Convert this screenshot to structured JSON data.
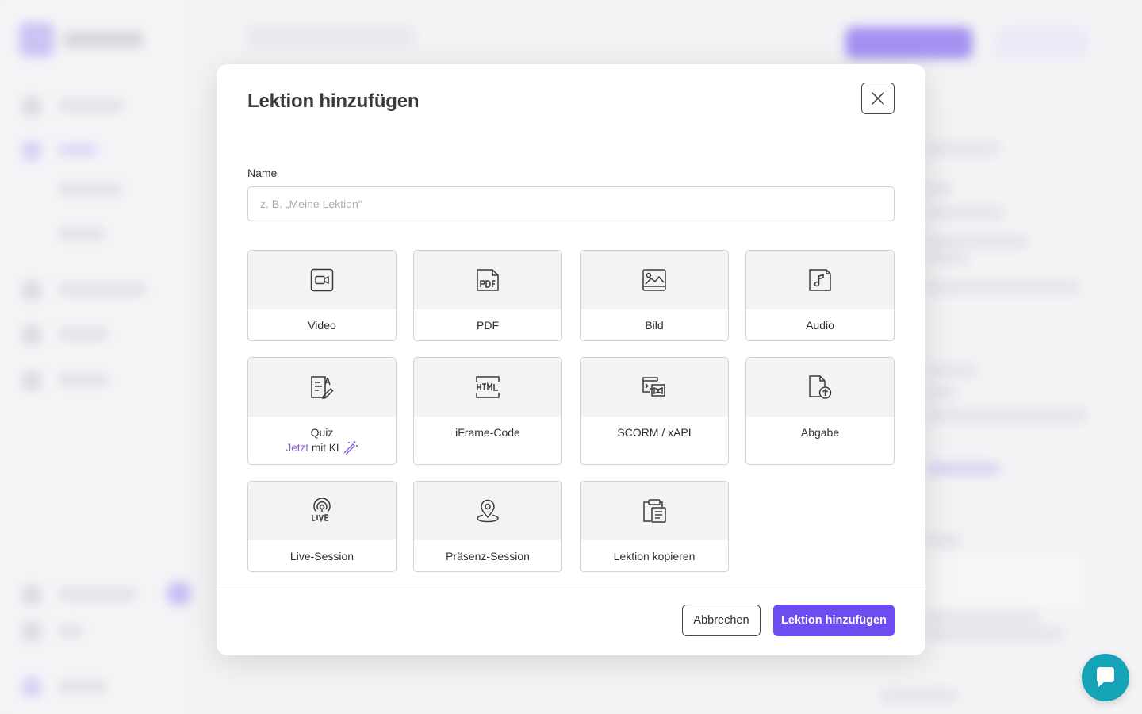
{
  "modal": {
    "title": "Lektion hinzufügen",
    "name_label": "Name",
    "name_placeholder": "z. B. „Meine Lektion“",
    "name_value": "",
    "cancel_label": "Abbrechen",
    "submit_label": "Lektion hinzufügen"
  },
  "lesson_types": [
    {
      "label": "Video",
      "icon": "video-camera-icon"
    },
    {
      "label": "PDF",
      "icon": "pdf-file-icon"
    },
    {
      "label": "Bild",
      "icon": "image-icon"
    },
    {
      "label": "Audio",
      "icon": "audio-file-icon"
    },
    {
      "label": "Quiz",
      "icon": "quiz-document-icon",
      "sub_accent": "Jetzt",
      "sub_rest": "mit KI",
      "sub_icon": "magic-wand-icon"
    },
    {
      "label": "iFrame-Code",
      "icon": "html-code-icon"
    },
    {
      "label": "SCORM / xAPI",
      "icon": "scorm-package-icon"
    },
    {
      "label": "Abgabe",
      "icon": "file-upload-icon"
    },
    {
      "label": "Live-Session",
      "icon": "live-broadcast-icon"
    },
    {
      "label": "Präsenz-Session",
      "icon": "location-pin-icon"
    },
    {
      "label": "Lektion kopieren",
      "icon": "clipboard-copy-icon"
    }
  ],
  "colors": {
    "accent": "#6d4df0",
    "chat": "#15a3b8",
    "ki_accent": "#8a63d2"
  }
}
